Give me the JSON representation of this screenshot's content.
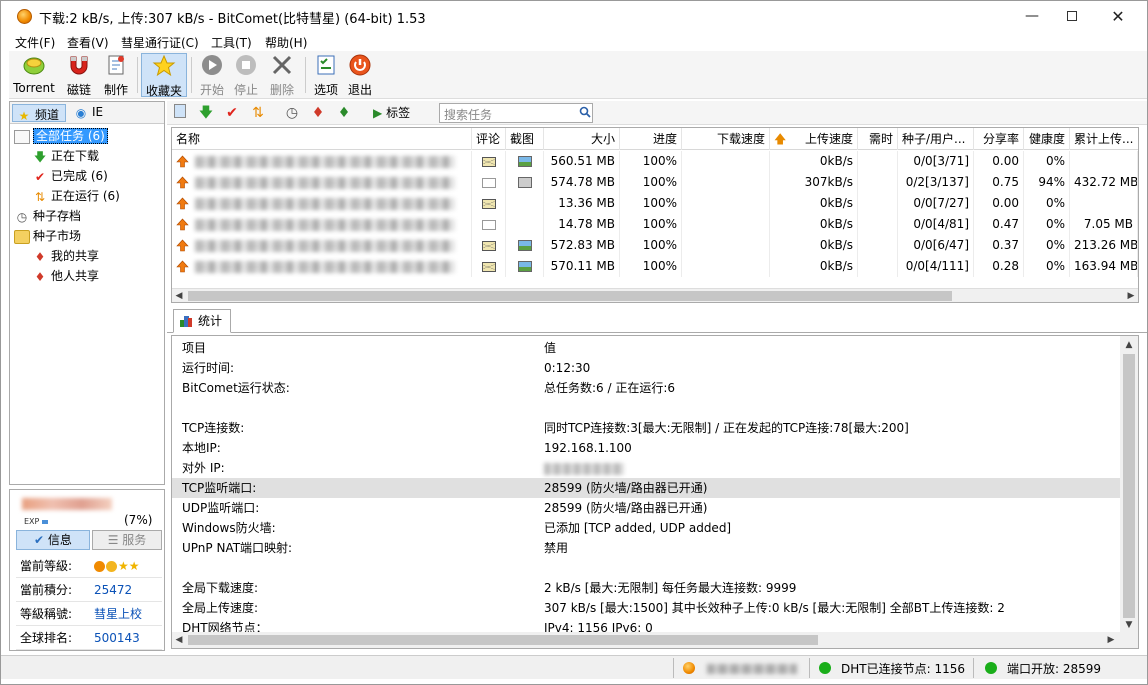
{
  "window": {
    "title": "下载:2 kB/s, 上传:307 kB/s - BitComet(比特彗星) (64-bit) 1.53"
  },
  "menu": [
    "文件(F)",
    "查看(V)",
    "彗星通行证(C)",
    "工具(T)",
    "帮助(H)"
  ],
  "toolbar": {
    "torrent": "Torrent",
    "magnet": "磁链",
    "make": "制作",
    "favorites": "收藏夹",
    "start": "开始",
    "stop": "停止",
    "delete": "删除",
    "options": "选项",
    "exit": "退出"
  },
  "left_tabs": {
    "channel": "频道",
    "ie": "IE"
  },
  "tree": {
    "all": "全部任务 (6)",
    "downloading": "正在下载",
    "completed": "已完成 (6)",
    "running": "正在运行 (6)",
    "archive": "种子存档",
    "market": "种子市场",
    "my_share": "我的共享",
    "others_share": "他人共享"
  },
  "user": {
    "exp_label": "EXP",
    "exp_pct": "(7%)",
    "exp_progress": 0.07,
    "tab_info": "信息",
    "tab_service": "服务",
    "rows": [
      {
        "k": "當前等級:",
        "v": ""
      },
      {
        "k": "當前積分:",
        "v": "25472"
      },
      {
        "k": "等級稱號:",
        "v": "彗星上校"
      },
      {
        "k": "全球排名:",
        "v": "500143"
      }
    ]
  },
  "main_toolbar": {
    "tags": "标签",
    "search_placeholder": "搜索任务"
  },
  "list": {
    "headers": [
      "名称",
      "评论",
      "截图",
      "大小",
      "进度",
      "下载速度",
      "上传速度",
      "需时",
      "种子/用户...",
      "分享率",
      "健康度",
      "累计上传..."
    ],
    "rows": [
      {
        "comment": "full",
        "shot": "color",
        "size": "560.51 MB",
        "progress": "100%",
        "down": "",
        "up": "0kB/s",
        "eta": "",
        "seeds": "0/0[3/71]",
        "ratio": "0.00",
        "health": "0%",
        "uploaded": ""
      },
      {
        "comment": "empty",
        "shot": "grey",
        "size": "574.78 MB",
        "progress": "100%",
        "down": "",
        "up": "307kB/s",
        "eta": "",
        "seeds": "0/2[3/137]",
        "ratio": "0.75",
        "health": "94%",
        "uploaded": "432.72 MB"
      },
      {
        "comment": "full",
        "shot": "none",
        "size": "13.36 MB",
        "progress": "100%",
        "down": "",
        "up": "0kB/s",
        "eta": "",
        "seeds": "0/0[7/27]",
        "ratio": "0.00",
        "health": "0%",
        "uploaded": ""
      },
      {
        "comment": "empty",
        "shot": "none",
        "size": "14.78 MB",
        "progress": "100%",
        "down": "",
        "up": "0kB/s",
        "eta": "",
        "seeds": "0/0[4/81]",
        "ratio": "0.47",
        "health": "0%",
        "uploaded": "7.05 MB"
      },
      {
        "comment": "full",
        "shot": "color",
        "size": "572.83 MB",
        "progress": "100%",
        "down": "",
        "up": "0kB/s",
        "eta": "",
        "seeds": "0/0[6/47]",
        "ratio": "0.37",
        "health": "0%",
        "uploaded": "213.26 MB"
      },
      {
        "comment": "full",
        "shot": "color",
        "size": "570.11 MB",
        "progress": "100%",
        "down": "",
        "up": "0kB/s",
        "eta": "",
        "seeds": "0/0[4/111]",
        "ratio": "0.28",
        "health": "0%",
        "uploaded": "163.94 MB"
      }
    ]
  },
  "stats": {
    "tab": "统计",
    "rows": [
      {
        "k": "项目",
        "v": "值"
      },
      {
        "k": "运行时间:",
        "v": "0:12:30"
      },
      {
        "k": "BitComet运行状态:",
        "v": "总任务数:6 / 正在运行:6"
      },
      {
        "k": "",
        "v": ""
      },
      {
        "k": "TCP连接数:",
        "v": "同时TCP连接数:3[最大:无限制] / 正在发起的TCP连接:78[最大:200]"
      },
      {
        "k": "本地IP:",
        "v": "192.168.1.100"
      },
      {
        "k": "对外 IP:",
        "v": ""
      },
      {
        "k": "TCP监听端口:",
        "v": "28599 (防火墙/路由器已开通)"
      },
      {
        "k": "UDP监听端口:",
        "v": "28599 (防火墙/路由器已开通)"
      },
      {
        "k": "Windows防火墙:",
        "v": "已添加 [TCP added, UDP added]"
      },
      {
        "k": "UPnP NAT端口映射:",
        "v": "禁用"
      },
      {
        "k": "",
        "v": ""
      },
      {
        "k": "全局下载速度:",
        "v": "2 kB/s [最大:无限制]     每任务最大连接数: 9999"
      },
      {
        "k": "全局上传速度:",
        "v": "307 kB/s [最大:1500]     其中长效种子上传:0 kB/s [最大:无限制]     全部BT上传连接数: 2"
      },
      {
        "k": "DHT网络节点：",
        "v": "IPv4: 1156  IPv6: 0"
      }
    ]
  },
  "status": {
    "dht": "DHT已连接节点: 1156",
    "port": "端口开放:  28599"
  },
  "colors": {
    "selection": "#3399ff",
    "link": "#0b52b7",
    "ok": "#1aae1a"
  }
}
